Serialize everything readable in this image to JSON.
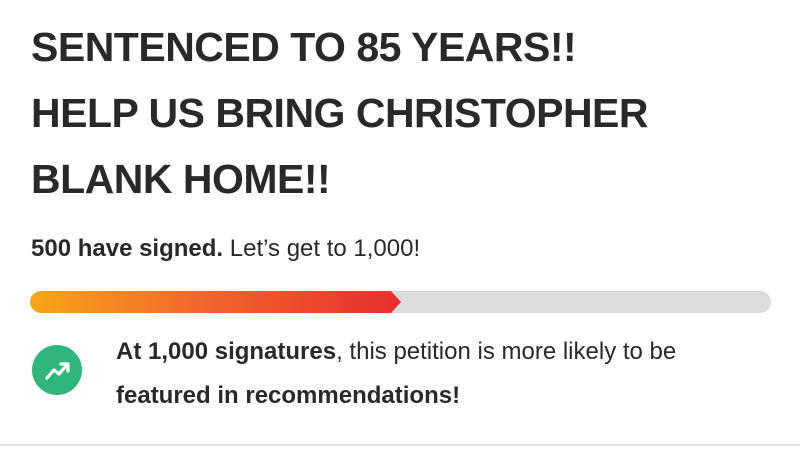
{
  "petition": {
    "title_lines": [
      "SENTENCED TO 85 YEARS!!",
      "HELP US BRING CHRISTOPHER",
      "BLANK HOME!!"
    ]
  },
  "signatures": {
    "count_text": "500 have signed.",
    "goal_text": " Let’s get to 1,000!",
    "signed": 500,
    "goal": 1000,
    "progress_fraction": 0.5
  },
  "milestone": {
    "icon": "trending-up-icon",
    "bold_lead": "At 1,000 signatures",
    "middle": ", this petition is more likely to be ",
    "bold_tail": "featured in recommendations!"
  },
  "colors": {
    "progress_start": "#f7a618",
    "progress_end": "#e8312e",
    "track": "#dcdcdc",
    "badge": "#2fb67a"
  }
}
